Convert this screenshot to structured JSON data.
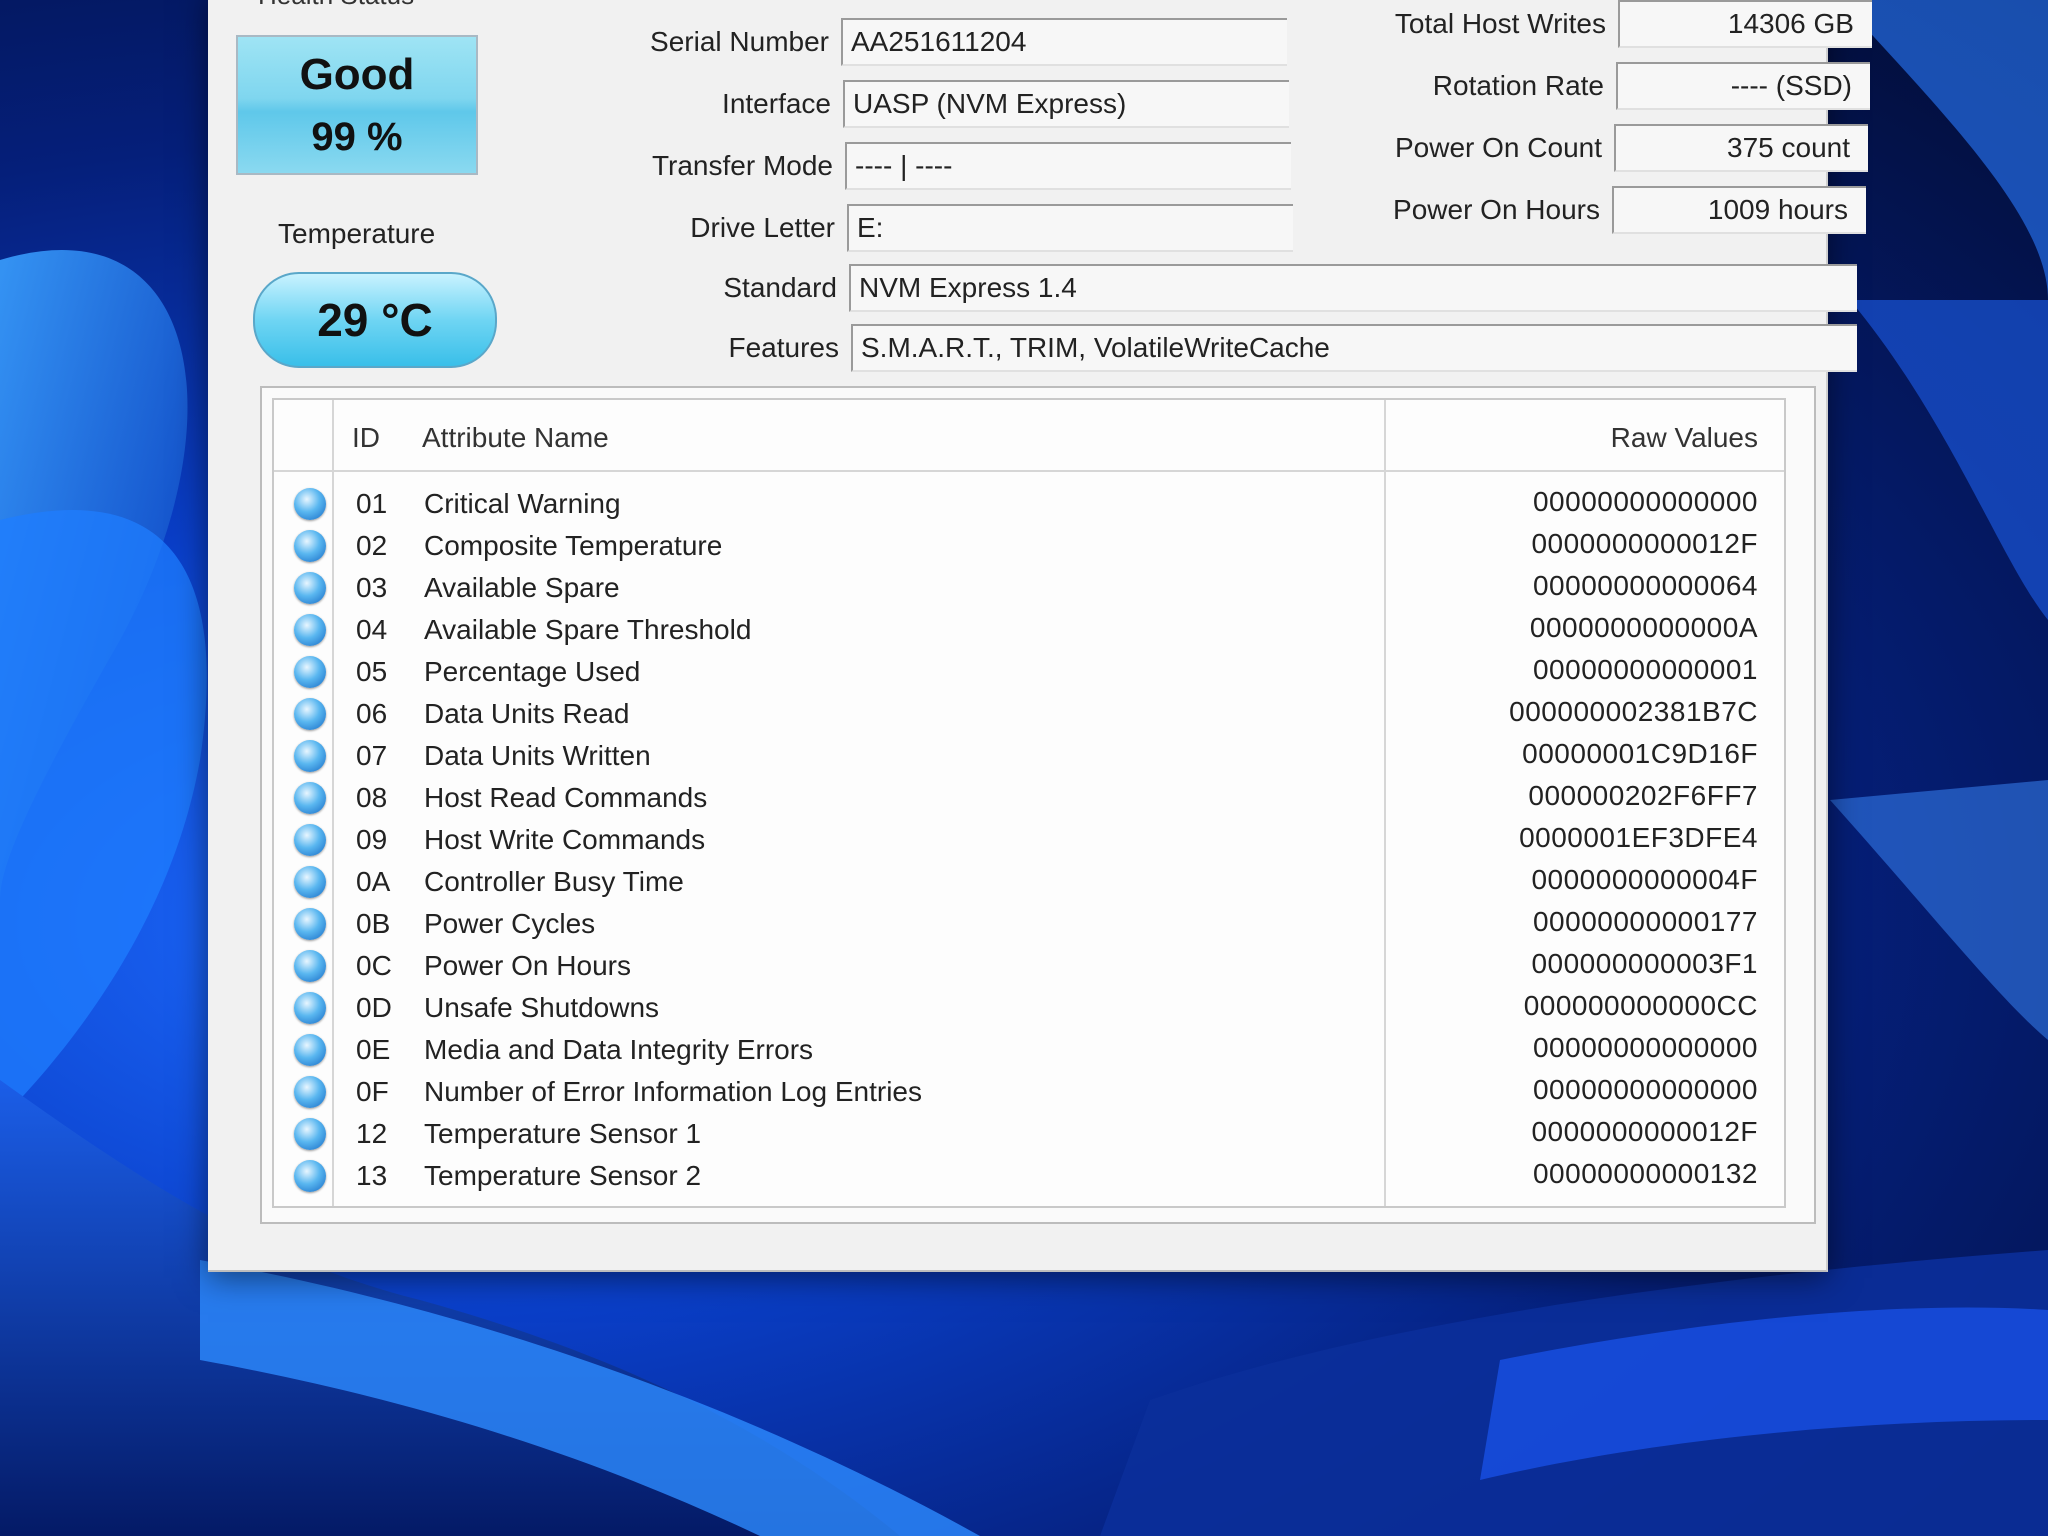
{
  "health": {
    "label": "Health Status",
    "status": "Good",
    "percent": "99 %",
    "color": "#7fd6ef"
  },
  "temperature": {
    "label": "Temperature",
    "value": "29 °C"
  },
  "info_left": [
    {
      "label": "Serial Number",
      "value": "AA251611204"
    },
    {
      "label": "Interface",
      "value": "UASP (NVM Express)"
    },
    {
      "label": "Transfer Mode",
      "value": "---- | ----"
    },
    {
      "label": "Drive Letter",
      "value": "E:"
    }
  ],
  "info_right": [
    {
      "label": "Total Host Writes",
      "value": "14306 GB"
    },
    {
      "label": "Rotation Rate",
      "value": "---- (SSD)"
    },
    {
      "label": "Power On Count",
      "value": "375 count"
    },
    {
      "label": "Power On Hours",
      "value": "1009 hours"
    }
  ],
  "standard": {
    "label": "Standard",
    "value": "NVM Express 1.4"
  },
  "features": {
    "label": "Features",
    "value": "S.M.A.R.T., TRIM, VolatileWriteCache"
  },
  "table": {
    "headers": {
      "id": "ID",
      "name": "Attribute Name",
      "raw": "Raw Values"
    },
    "rows": [
      {
        "id": "01",
        "name": "Critical Warning",
        "raw": "00000000000000"
      },
      {
        "id": "02",
        "name": "Composite Temperature",
        "raw": "0000000000012F"
      },
      {
        "id": "03",
        "name": "Available Spare",
        "raw": "00000000000064"
      },
      {
        "id": "04",
        "name": "Available Spare Threshold",
        "raw": "0000000000000A"
      },
      {
        "id": "05",
        "name": "Percentage Used",
        "raw": "00000000000001"
      },
      {
        "id": "06",
        "name": "Data Units Read",
        "raw": "000000002381B7C"
      },
      {
        "id": "07",
        "name": "Data Units Written",
        "raw": "00000001C9D16F"
      },
      {
        "id": "08",
        "name": "Host Read Commands",
        "raw": "000000202F6FF7"
      },
      {
        "id": "09",
        "name": "Host Write Commands",
        "raw": "0000001EF3DFE4"
      },
      {
        "id": "0A",
        "name": "Controller Busy Time",
        "raw": "0000000000004F"
      },
      {
        "id": "0B",
        "name": "Power Cycles",
        "raw": "00000000000177"
      },
      {
        "id": "0C",
        "name": "Power On Hours",
        "raw": "000000000003F1"
      },
      {
        "id": "0D",
        "name": "Unsafe Shutdowns",
        "raw": "000000000000CC"
      },
      {
        "id": "0E",
        "name": "Media and Data Integrity Errors",
        "raw": "00000000000000"
      },
      {
        "id": "0F",
        "name": "Number of Error Information Log Entries",
        "raw": "00000000000000"
      },
      {
        "id": "12",
        "name": "Temperature Sensor 1",
        "raw": "0000000000012F"
      },
      {
        "id": "13",
        "name": "Temperature Sensor 2",
        "raw": "00000000000132"
      }
    ]
  }
}
